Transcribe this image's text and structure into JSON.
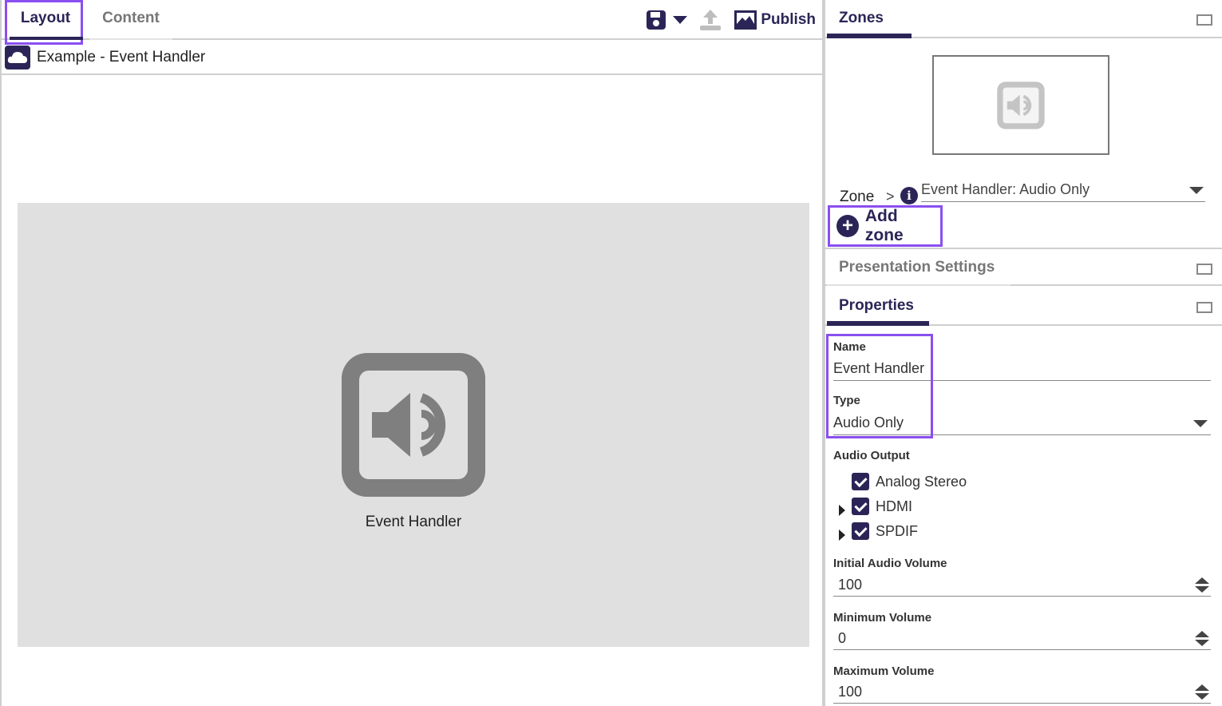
{
  "tabs": {
    "layout": "Layout",
    "content": "Content"
  },
  "toolbar": {
    "publish_label": "Publish"
  },
  "document": {
    "title": "Example - Event Handler"
  },
  "canvas": {
    "zone_label": "Event Handler"
  },
  "zones_panel": {
    "title": "Zones",
    "zone_label": "Zone",
    "zone_selected": "Event Handler: Audio Only",
    "add_zone_label": "Add zone"
  },
  "presentation_settings": {
    "title": "Presentation Settings"
  },
  "properties": {
    "title": "Properties",
    "name_label": "Name",
    "name_value": "Event Handler",
    "type_label": "Type",
    "type_value": "Audio Only",
    "audio_output_label": "Audio Output",
    "outputs": [
      {
        "label": "Analog Stereo",
        "checked": true
      },
      {
        "label": "HDMI",
        "checked": true
      },
      {
        "label": "SPDIF",
        "checked": true
      }
    ],
    "initial_volume_label": "Initial Audio Volume",
    "initial_volume_value": "100",
    "min_volume_label": "Minimum Volume",
    "min_volume_value": "0",
    "max_volume_label": "Maximum Volume",
    "max_volume_value": "100"
  },
  "colors": {
    "brand": "#2b2557",
    "highlight": "#8a4ff0",
    "canvas": "#e0e0e0",
    "icon": "#7f7f7f"
  },
  "icons": [
    "save-icon",
    "dropdown-caret-icon",
    "upload-icon",
    "publish-icon",
    "cloud-icon",
    "audio-zone-icon",
    "info-icon",
    "plus-icon",
    "maximize-icon",
    "checkbox-icon",
    "spinner-icon"
  ]
}
